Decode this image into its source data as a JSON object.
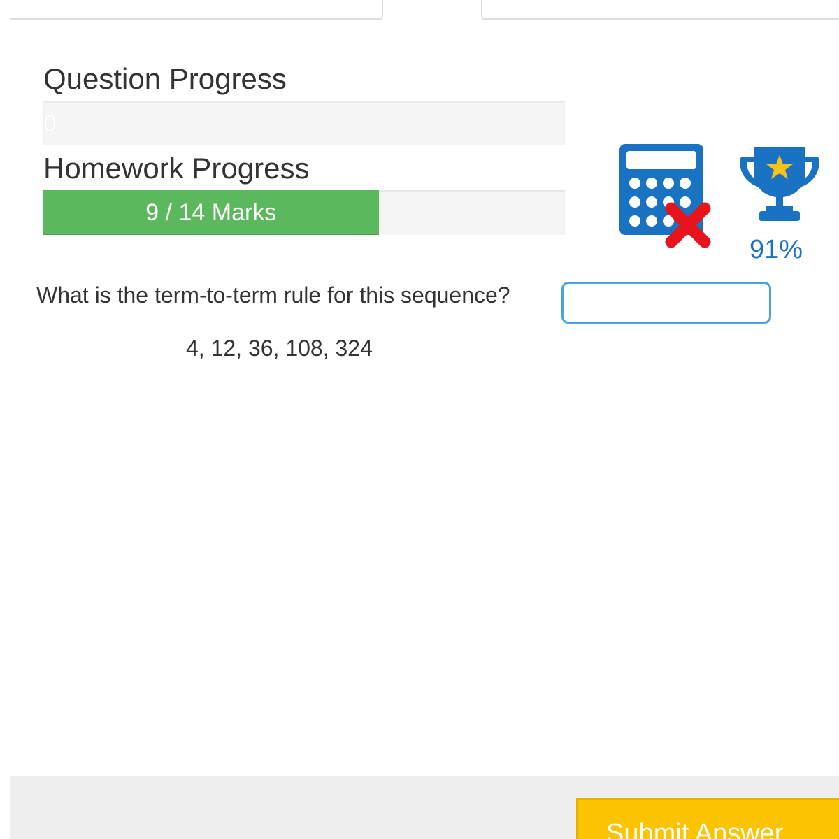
{
  "question_progress": {
    "label": "Question Progress",
    "value_text": "0",
    "fraction": 0
  },
  "homework_progress": {
    "label": "Homework Progress",
    "value_text": "9 / 14 Marks",
    "marks_earned": 9,
    "marks_total": 14
  },
  "icons": {
    "calculator": "calculator-not-allowed-icon",
    "trophy": "trophy-icon"
  },
  "score": {
    "percent_text": "91%"
  },
  "question": {
    "prompt": "What is the term-to-term rule for this sequence?",
    "sequence": "4, 12, 36, 108, 324",
    "answer_value": "",
    "answer_placeholder": ""
  },
  "footer": {
    "submit_label": "Submit Answer"
  },
  "colors": {
    "progress_green": "#5cb85c",
    "accent_blue": "#1a73c2",
    "submit_yellow": "#fcc400",
    "cross_red": "#e8141c"
  }
}
